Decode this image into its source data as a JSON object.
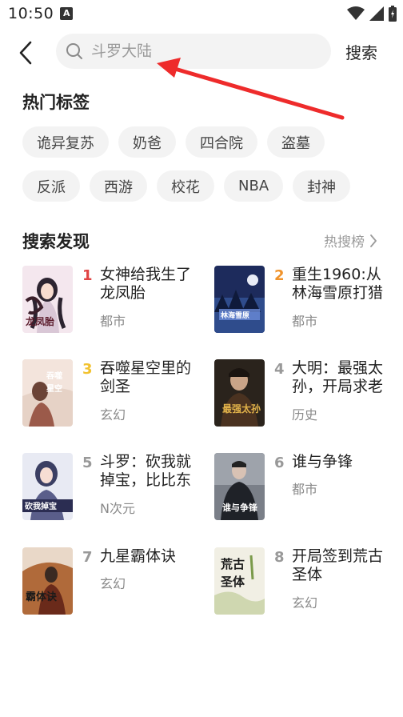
{
  "status": {
    "time": "10:50",
    "notif_letter": "A"
  },
  "search": {
    "placeholder": "斗罗大陆",
    "button_label": "搜索"
  },
  "hot_tags": {
    "title": "热门标签",
    "row1": [
      "诡异复苏",
      "奶爸",
      "四合院",
      "盗墓"
    ],
    "row2": [
      "反派",
      "西游",
      "校花",
      "NBA",
      "封神"
    ]
  },
  "discover": {
    "title": "搜索发现",
    "hot_link": "热搜榜",
    "books": [
      {
        "rank": "1",
        "rank_color": "#e04343",
        "title": "女神给我生了龙凤胎",
        "genre": "都市",
        "cover_icon": "anime-girl-cover"
      },
      {
        "rank": "2",
        "rank_color": "#f0932b",
        "title": "重生1960:从林海雪原打猎",
        "genre": "都市",
        "cover_icon": "snowy-forest-cover"
      },
      {
        "rank": "3",
        "rank_color": "#f2c230",
        "title": "吞噬星空里的剑圣",
        "genre": "玄幻",
        "cover_icon": "swordsman-cover"
      },
      {
        "rank": "4",
        "rank_color": "#999999",
        "title": "大明：最强太孙，开局求老",
        "genre": "历史",
        "cover_icon": "ming-prince-cover"
      },
      {
        "rank": "5",
        "rank_color": "#999999",
        "title": "斗罗：砍我就掉宝，比比东",
        "genre": "N次元",
        "cover_icon": "anime-girl-cover"
      },
      {
        "rank": "6",
        "rank_color": "#999999",
        "title": "谁与争锋",
        "genre": "都市",
        "cover_icon": "suit-man-cover"
      },
      {
        "rank": "7",
        "rank_color": "#999999",
        "title": "九星霸体诀",
        "genre": "玄幻",
        "cover_icon": "warrior-cover"
      },
      {
        "rank": "8",
        "rank_color": "#999999",
        "title": "开局签到荒古圣体",
        "genre": "玄幻",
        "cover_icon": "calligraphy-cover"
      }
    ]
  }
}
